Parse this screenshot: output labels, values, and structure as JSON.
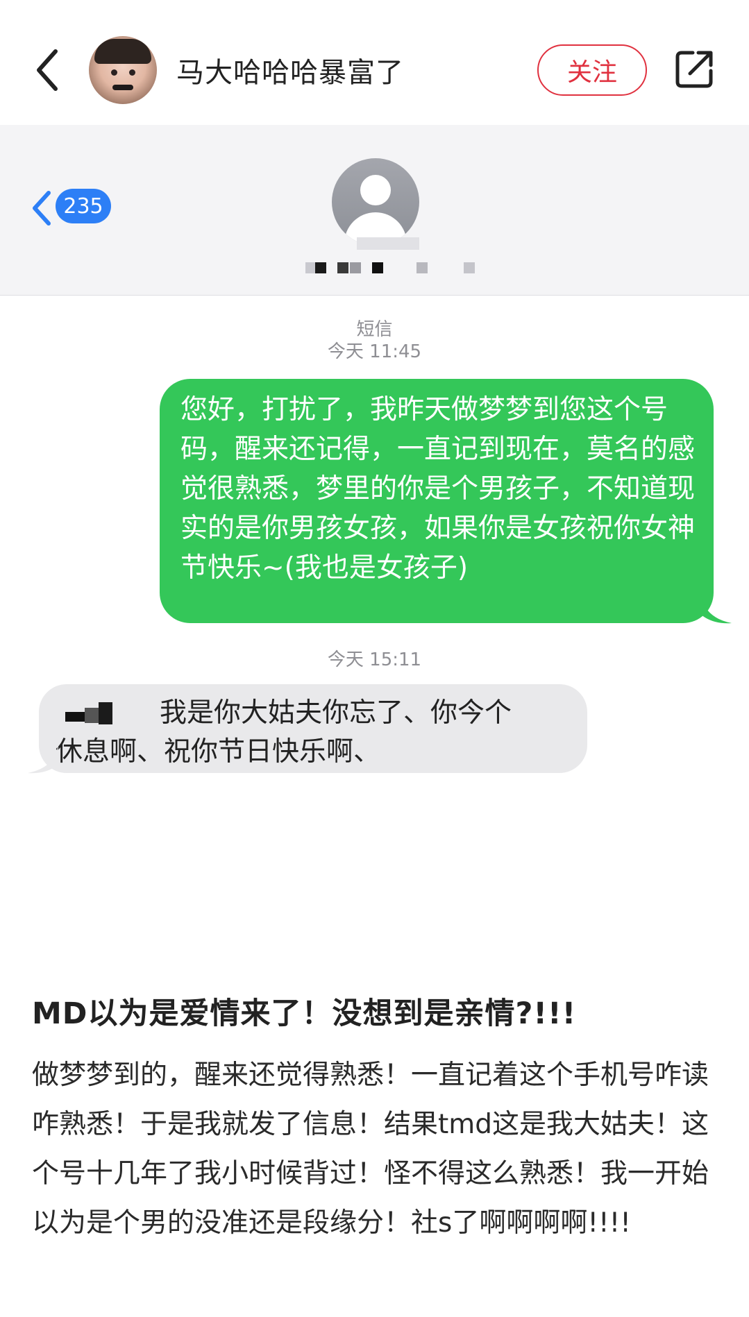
{
  "header": {
    "author_name": "马大哈哈哈暴富了",
    "follow_label": "关注"
  },
  "screenshot": {
    "unread_count": "235",
    "channel_label": "短信",
    "time_1": "今天 11:45",
    "time_2": "今天 15:11",
    "outgoing_message": "您好，打扰了，我昨天做梦梦到您这个号码，醒来还记得，一直记到现在，莫名的感觉很熟悉，梦里的你是个男孩子，不知道现实的是你男孩女孩，如果你是女孩祝你女神节快乐~(我也是女孩子)",
    "incoming_line1": "我是你大姑夫你忘了、你今个",
    "incoming_line2": "休息啊、祝你节日快乐啊、",
    "bubble_colors": {
      "outgoing": "#34c759",
      "incoming": "#e9e9eb"
    }
  },
  "post": {
    "title": "MD以为是爱情来了！没想到是亲情?!!!",
    "body": "做梦梦到的，醒来还觉得熟悉！一直记着这个手机号咋读咋熟悉！于是我就发了信息！结果tmd这是我大姑夫！这个号十几年了我小时候背过！怪不得这么熟悉！我一开始以为是个男的没准还是段缘分！社s了啊啊啊啊!!!!"
  },
  "icons": {
    "back": "chevron-left-icon",
    "share": "share-icon",
    "contact": "person-icon"
  },
  "colors": {
    "follow": "#e0313f",
    "badge": "#2d7ff6"
  }
}
